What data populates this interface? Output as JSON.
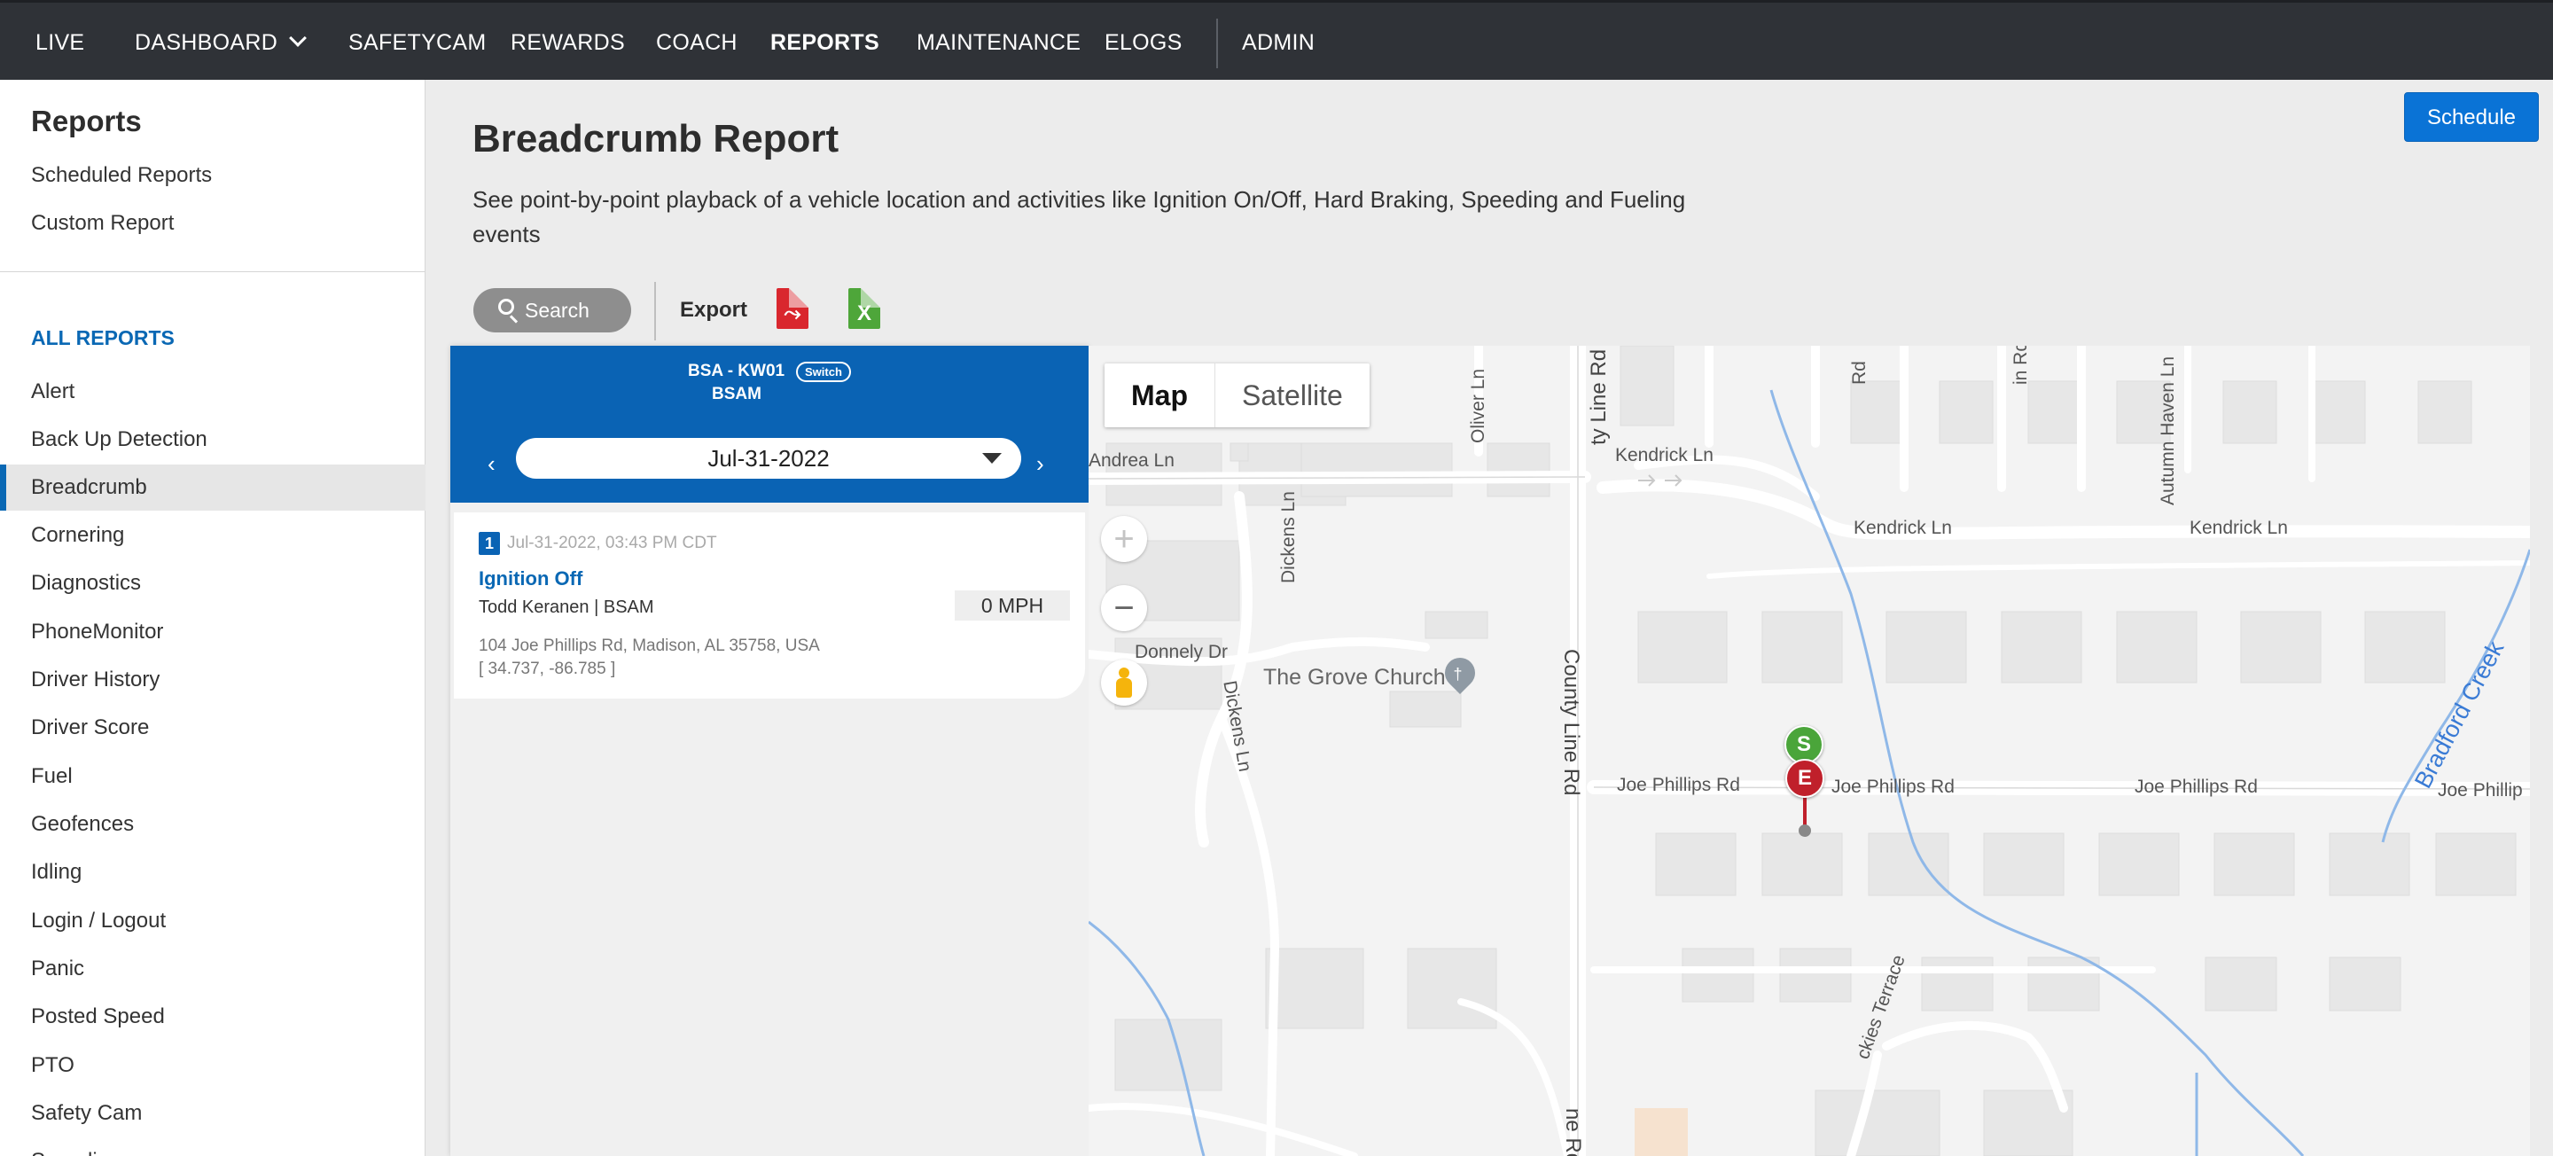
{
  "nav": {
    "live": "LIVE",
    "dashboard": "DASHBOARD",
    "safetycam": "SAFETYCAM",
    "rewards": "REWARDS",
    "coach": "COACH",
    "reports": "REPORTS",
    "maintenance": "MAINTENANCE",
    "elogs": "ELOGS",
    "admin": "ADMIN",
    "active": "REPORTS"
  },
  "sidebar": {
    "title": "Reports",
    "links": [
      "Scheduled Reports",
      "Custom Report"
    ],
    "section": "ALL REPORTS",
    "items": [
      "Alert",
      "Back Up Detection",
      "Breadcrumb",
      "Cornering",
      "Diagnostics",
      "PhoneMonitor",
      "Driver History",
      "Driver Score",
      "Fuel",
      "Geofences",
      "Idling",
      "Login / Logout",
      "Panic",
      "Posted Speed",
      "PTO",
      "Safety Cam",
      "Speeding"
    ],
    "active_item": "Breadcrumb"
  },
  "header": {
    "title": "Breadcrumb Report",
    "description": "See point-by-point playback of a vehicle location and activities like Ignition On/Off, Hard Braking, Speeding and Fueling events",
    "schedule_label": "Schedule"
  },
  "toolbar": {
    "search_label": "Search",
    "export_label": "Export",
    "pdf_icon": "pdf-file-icon",
    "excel_icon": "excel-file-icon"
  },
  "panel": {
    "vehicle": "BSA - KW01",
    "switch_label": "Switch",
    "group": "BSAM",
    "date": "Jul-31-2022",
    "prev_arrow": "‹",
    "next_arrow": "›"
  },
  "event": {
    "number": "1",
    "timestamp": "Jul-31-2022, 03:43 PM CDT",
    "type": "Ignition Off",
    "driver": "Todd Keranen | BSAM",
    "speed": "0 MPH",
    "address": "104 Joe Phillips Rd, Madison, AL 35758, USA",
    "coordinates": "[ 34.737, -86.785 ]"
  },
  "map": {
    "map_label": "Map",
    "satellite_label": "Satellite",
    "zoom_in": "+",
    "zoom_out": "−",
    "poi": "The Grove Church",
    "creek": "Bradford Creek",
    "start_marker": "S",
    "end_marker": "E",
    "streets": {
      "andrea_ln": "Andrea Ln",
      "oliver_ln": "Oliver Ln",
      "county_line_top": "ty Line Rd",
      "kendrick_ln_1": "Kendrick Ln",
      "kendrick_ln_2": "Kendrick Ln",
      "kendrick_ln_3": "Kendrick Ln",
      "rd_1": "Rd",
      "in_rd": "in Rd",
      "autumn_haven": "Autumn Haven Ln",
      "dickens_ln_1": "Dickens Ln",
      "dickens_ln_2": "Dickens Ln",
      "donnely_dr": "Donnely Dr",
      "county_line_rd": "County Line Rd",
      "joe_phillips_1": "Joe Phillips Rd",
      "joe_phillips_2": "Joe Phillips Rd",
      "joe_phillips_3": "Joe Phillips Rd",
      "joe_phillips_4": "Joe Phillip",
      "ckies_terrace": "ckies Terrace",
      "ne_rd": "ne Rd"
    }
  }
}
